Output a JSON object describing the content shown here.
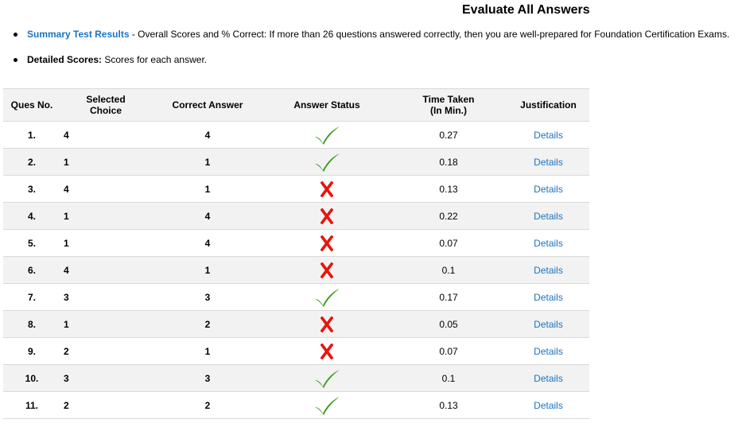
{
  "page": {
    "title": "Evaluate All Answers",
    "summary": {
      "link_label": "Summary Test Results",
      "text": " - Overall Scores and % Correct: If more than 26 questions answered correctly, then you are well-prepared for Foundation Certification Exams."
    },
    "detailed": {
      "label": "Detailed Scores:",
      "text": " Scores for each answer."
    }
  },
  "colors": {
    "link": "#1a73c4",
    "correct": "#3a9a1e",
    "incorrect": "#e8150c",
    "header_bg": "#f2f2f2"
  },
  "table": {
    "headers": {
      "ques_no": "Ques No.",
      "selected_line1": "Selected",
      "selected_line2": "Choice",
      "correct_answer": "Correct Answer",
      "answer_status": "Answer Status",
      "time_line1": "Time Taken",
      "time_line2": "(In Min.)",
      "justification": "Justification"
    },
    "rows": [
      {
        "q": "1.",
        "selected": "4",
        "correct": "4",
        "status": "correct",
        "status_icon": "checkmark-icon",
        "time": "0.27",
        "link": "Details"
      },
      {
        "q": "2.",
        "selected": "1",
        "correct": "1",
        "status": "correct",
        "status_icon": "checkmark-icon",
        "time": "0.18",
        "link": "Details"
      },
      {
        "q": "3.",
        "selected": "4",
        "correct": "1",
        "status": "incorrect",
        "status_icon": "cross-icon",
        "time": "0.13",
        "link": "Details"
      },
      {
        "q": "4.",
        "selected": "1",
        "correct": "4",
        "status": "incorrect",
        "status_icon": "cross-icon",
        "time": "0.22",
        "link": "Details"
      },
      {
        "q": "5.",
        "selected": "1",
        "correct": "4",
        "status": "incorrect",
        "status_icon": "cross-icon",
        "time": "0.07",
        "link": "Details"
      },
      {
        "q": "6.",
        "selected": "4",
        "correct": "1",
        "status": "incorrect",
        "status_icon": "cross-icon",
        "time": "0.1",
        "link": "Details"
      },
      {
        "q": "7.",
        "selected": "3",
        "correct": "3",
        "status": "correct",
        "status_icon": "checkmark-icon",
        "time": "0.17",
        "link": "Details"
      },
      {
        "q": "8.",
        "selected": "1",
        "correct": "2",
        "status": "incorrect",
        "status_icon": "cross-icon",
        "time": "0.05",
        "link": "Details"
      },
      {
        "q": "9.",
        "selected": "2",
        "correct": "1",
        "status": "incorrect",
        "status_icon": "cross-icon",
        "time": "0.07",
        "link": "Details"
      },
      {
        "q": "10.",
        "selected": "3",
        "correct": "3",
        "status": "correct",
        "status_icon": "checkmark-icon",
        "time": "0.1",
        "link": "Details"
      },
      {
        "q": "11.",
        "selected": "2",
        "correct": "2",
        "status": "correct",
        "status_icon": "checkmark-icon",
        "time": "0.13",
        "link": "Details"
      }
    ]
  }
}
